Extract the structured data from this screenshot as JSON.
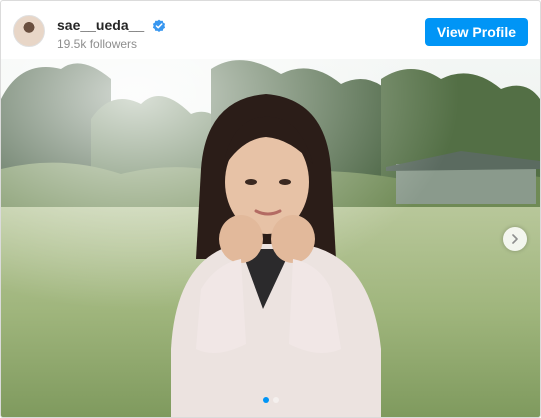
{
  "profile": {
    "username": "sae__ueda__",
    "followers": "19.5k followers",
    "view_profile_label": "View Profile",
    "verified_icon": "verified-badge-icon",
    "avatar_icon": "avatar"
  },
  "media": {
    "description_icon": "photo-woman-lying-on-lawn",
    "next_icon": "chevron-right-icon",
    "carousel": {
      "total": 2,
      "active_index": 1
    }
  },
  "colors": {
    "accent": "#0095f6",
    "username": "#262626",
    "secondary_text": "#8e8e8e",
    "border": "#dbdbdb"
  }
}
